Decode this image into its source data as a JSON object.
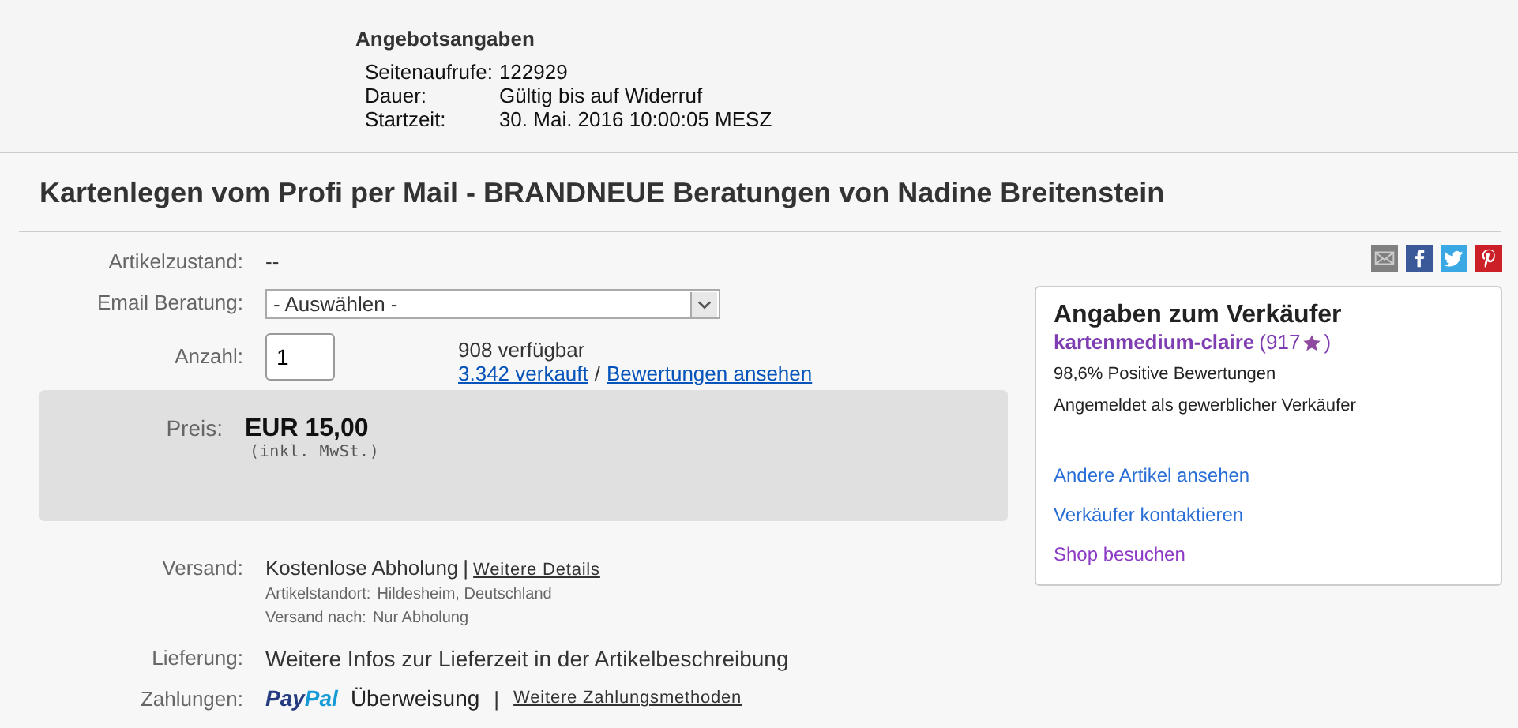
{
  "offer_info": {
    "title": "Angebotsangaben",
    "rows": [
      {
        "label": "Seitenaufrufe:",
        "value": "122929"
      },
      {
        "label": "Dauer:",
        "value": "Gültig bis auf Widerruf"
      },
      {
        "label": "Startzeit:",
        "value": "30. Mai. 2016 10:00:05 MESZ"
      }
    ]
  },
  "item_title": "Kartenlegen vom Profi per Mail - BRANDNEUE Beratungen von Nadine Breitenstein",
  "condition": {
    "label": "Artikelzustand:",
    "value": "--"
  },
  "variant": {
    "label": "Email Beratung:",
    "value": "- Auswählen -"
  },
  "quantity": {
    "label": "Anzahl:",
    "value": "1",
    "available": "908 verfügbar",
    "sold_link": "3.342 verkauft",
    "separator": "/",
    "reviews_link": "Bewertungen ansehen"
  },
  "price": {
    "label": "Preis:",
    "value": "EUR 15,00",
    "note": "(inkl. MwSt.)"
  },
  "shipping": {
    "label": "Versand:",
    "value": "Kostenlose Abholung",
    "separator": "|",
    "details_link": "Weitere Details",
    "location_label": "Artikelstandort:",
    "location": "Hildesheim, Deutschland",
    "ships_to_label": "Versand nach:",
    "ships_to": "Nur Abholung"
  },
  "delivery": {
    "label": "Lieferung:",
    "value": "Weitere Infos zur Lieferzeit in der Artikelbeschreibung"
  },
  "payments": {
    "label": "Zahlungen:",
    "paypal": [
      "Pay",
      "Pal"
    ],
    "methods": "Überweisung",
    "separator": "|",
    "more_link": "Weitere Zahlungsmethoden"
  },
  "share_icons": [
    {
      "kind": "mail"
    },
    {
      "kind": "facebook"
    },
    {
      "kind": "twitter"
    },
    {
      "kind": "pinterest"
    }
  ],
  "seller": {
    "title": "Angaben zum Verkäufer",
    "name": "kartenmedium-claire",
    "score_open": "(917",
    "score_close": ")",
    "positive": "98,6% Positive Bewertungen",
    "registered": "Angemeldet als gewerblicher Verkäufer",
    "links": [
      {
        "label": "Andere Artikel ansehen",
        "visited": false
      },
      {
        "label": "Verkäufer kontaktieren",
        "visited": false
      },
      {
        "label": "Shop besuchen",
        "visited": true
      }
    ]
  }
}
